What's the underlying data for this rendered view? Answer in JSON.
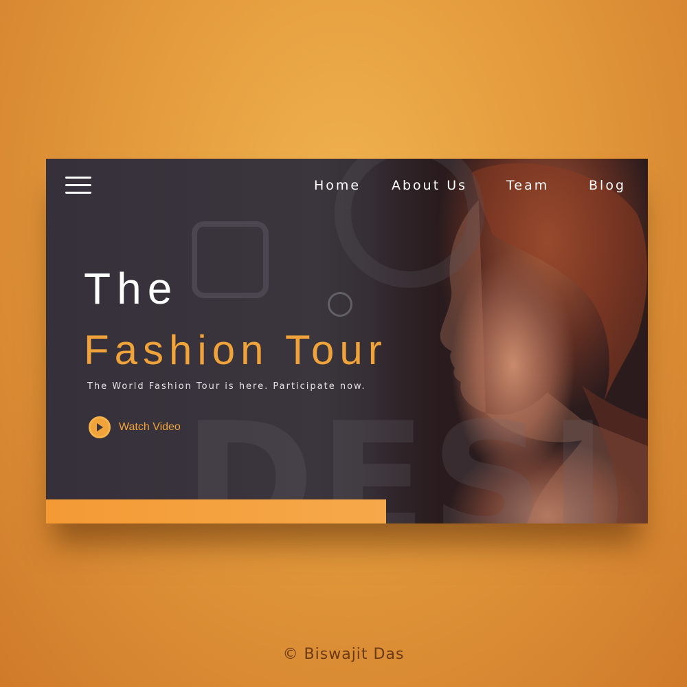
{
  "nav": {
    "menu_icon": "hamburger-menu-icon",
    "items": [
      {
        "label": "Home"
      },
      {
        "label": "About Us"
      },
      {
        "label": "Team"
      },
      {
        "label": "Blog"
      }
    ]
  },
  "hero": {
    "title_line1": "The",
    "title_line2": "Fashion Tour",
    "subtitle": "The World Fashion Tour is here. Participate now.",
    "watch_label": "Watch Video",
    "play_icon": "play-icon",
    "background_word": "DESI"
  },
  "colors": {
    "accent": "#f0a33a",
    "card_bg": "#35303a",
    "page_bg": "#e39a3c"
  },
  "footer": {
    "credit": "© Biswajit Das"
  }
}
